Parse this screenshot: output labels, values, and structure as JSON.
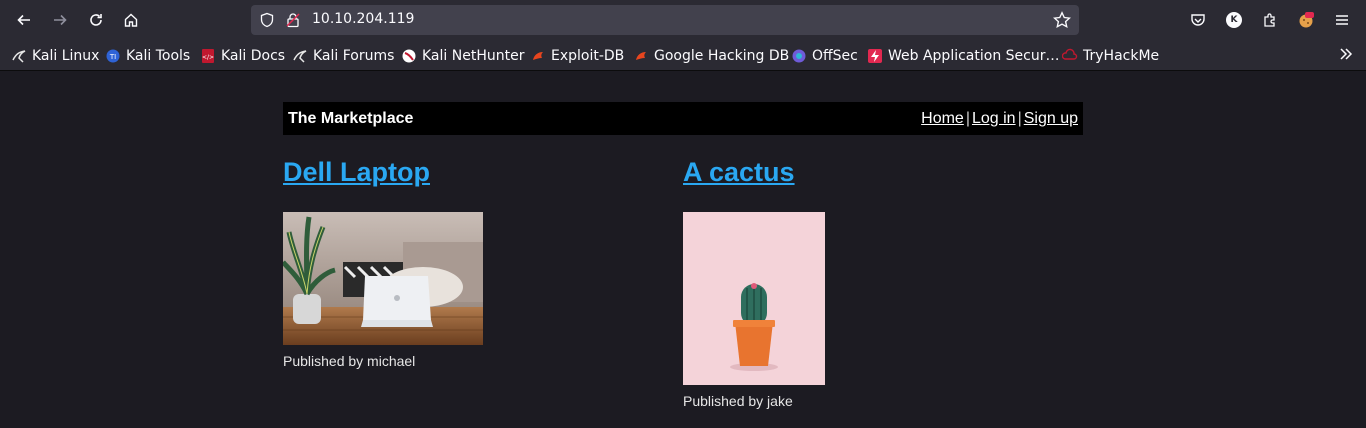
{
  "browser": {
    "url": "10.10.204.119",
    "bookmarks": [
      {
        "label": "Kali Linux",
        "icon": "kali-dragon-icon"
      },
      {
        "label": "Kali Tools",
        "icon": "kali-tools-icon"
      },
      {
        "label": "Kali Docs",
        "icon": "kali-docs-icon"
      },
      {
        "label": "Kali Forums",
        "icon": "kali-dragon-icon"
      },
      {
        "label": "Kali NetHunter",
        "icon": "nethunter-icon"
      },
      {
        "label": "Exploit-DB",
        "icon": "exploitdb-icon"
      },
      {
        "label": "Google Hacking DB",
        "icon": "exploitdb-icon"
      },
      {
        "label": "OffSec",
        "icon": "offsec-icon"
      },
      {
        "label": "Web Application Secur…",
        "icon": "bolt-icon"
      },
      {
        "label": "TryHackMe",
        "icon": "tryhackme-icon"
      }
    ],
    "avatar_letter": "K"
  },
  "site": {
    "title": "The Marketplace",
    "nav": {
      "home": "Home",
      "login": "Log in",
      "signup": "Sign up",
      "separator": "|"
    }
  },
  "items": [
    {
      "title": "Dell Laptop",
      "published": "Published by michael",
      "image": "laptop-photo"
    },
    {
      "title": "A cactus",
      "published": "Published by jake",
      "image": "cactus-photo"
    }
  ],
  "colors": {
    "link": "#2aa8f2",
    "chrome": "#2b2a33",
    "page_bg": "#1c1b22"
  }
}
